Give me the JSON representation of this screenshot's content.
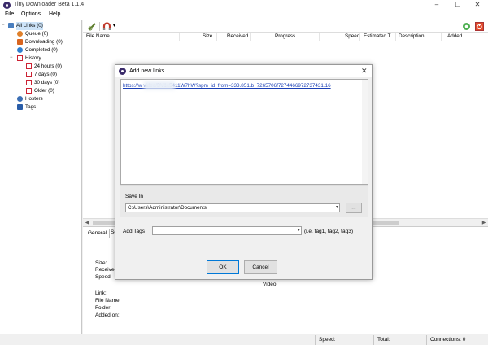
{
  "app": {
    "title": "Tiny Downloader Beta 1.1.4"
  },
  "window_controls": {
    "minimize": "–",
    "maximize": "☐",
    "close": "✕"
  },
  "menu": [
    "File",
    "Options",
    "Help"
  ],
  "tree": {
    "all_links": "All Links (0)",
    "queue": "Queue (0)",
    "downloading": "Downloading (0)",
    "completed": "Completed (0)",
    "history": "History",
    "h24": "24 hours (0)",
    "d7": "7 days (0)",
    "d30": "30 days (0)",
    "older": "Older (0)",
    "hosters": "Hosters",
    "tags": "Tags",
    "expand_minus": "−"
  },
  "grid": {
    "columns": [
      "File Name",
      "Size",
      "Received",
      "Progress",
      "Speed",
      "Estimated T...",
      "Description",
      "Added"
    ]
  },
  "scroll": {
    "left": "◀",
    "right": "▶"
  },
  "details": {
    "tabs": [
      "General",
      "Se"
    ],
    "labels": {
      "size": "Size:",
      "received": "Received",
      "speed": "Speed:",
      "video": "Video:",
      "link": "Link:",
      "file_name": "File Name:",
      "folder": "Folder:",
      "added_on": "Added on:"
    }
  },
  "status": {
    "speed": "Speed:",
    "total": "Total:",
    "connections": "Connections: 0"
  },
  "dialog": {
    "title": "Add new links",
    "close": "✕",
    "links_text": "https://w                 video/BV1c5411W7hW?spm_id_from=333.851.b_7265706f7274466972737431.16",
    "save_in_label": "Save In",
    "save_path": "C:\\Users\\Administrator\\Documents",
    "browse_label": "...",
    "add_tags_label": "Add Tags",
    "tags_value": "",
    "tags_hint": "(i.e. tag1, tag2, tag3)",
    "ok": "OK",
    "cancel": "Cancel"
  },
  "colors": {
    "link": "#1a3fb5",
    "selected": "#cce3f8",
    "primary_border": "#0078d7"
  }
}
